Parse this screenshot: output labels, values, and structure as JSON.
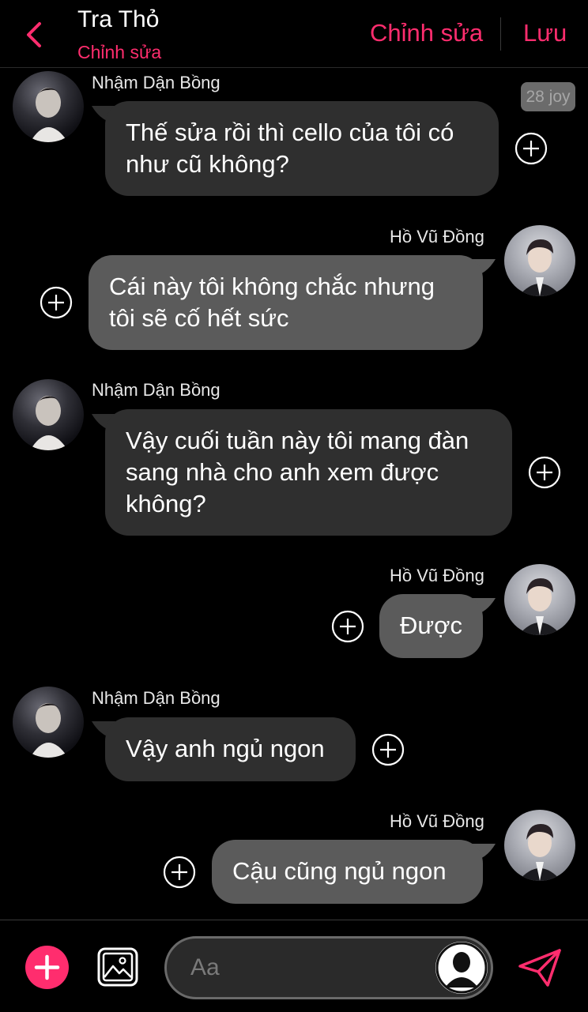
{
  "header": {
    "title": "Tra Thỏ",
    "subtitle": "Chỉnh sửa",
    "edit_label": "Chỉnh sửa",
    "save_label": "Lưu"
  },
  "stamp": "28 joy",
  "messages": [
    {
      "sender": "Nhậm Dận Bồng",
      "side": "left",
      "lines": [
        "Thế sửa rồi thì cello của tôi có",
        "như cũ không?"
      ]
    },
    {
      "sender": "Hồ Vũ Đồng",
      "side": "right",
      "lines": [
        "Cái này tôi không chắc nhưng",
        "tôi sẽ cố hết sức"
      ]
    },
    {
      "sender": "Nhậm Dận Bồng",
      "side": "left",
      "lines": [
        "Vậy cuối tuần này tôi mang đàn",
        "sang nhà cho anh xem được",
        "không?"
      ]
    },
    {
      "sender": "Hồ Vũ Đồng",
      "side": "right",
      "lines": [
        "Được"
      ]
    },
    {
      "sender": "Nhậm Dận Bồng",
      "side": "left",
      "lines": [
        "Vậy anh ngủ ngon"
      ]
    },
    {
      "sender": "Hồ Vũ Đồng",
      "side": "right",
      "lines": [
        "Cậu cũng ngủ ngon"
      ]
    }
  ],
  "composer": {
    "placeholder": "Aa"
  },
  "icons": {
    "back": "chevron-left-icon",
    "add": "plus-icon",
    "image": "image-icon",
    "send": "send-icon",
    "react": "add-circle-icon"
  },
  "colors": {
    "accent": "#ff2d6e",
    "background": "#000000",
    "bubble_left": "#2f2f2f",
    "bubble_right": "#5b5b5b"
  }
}
